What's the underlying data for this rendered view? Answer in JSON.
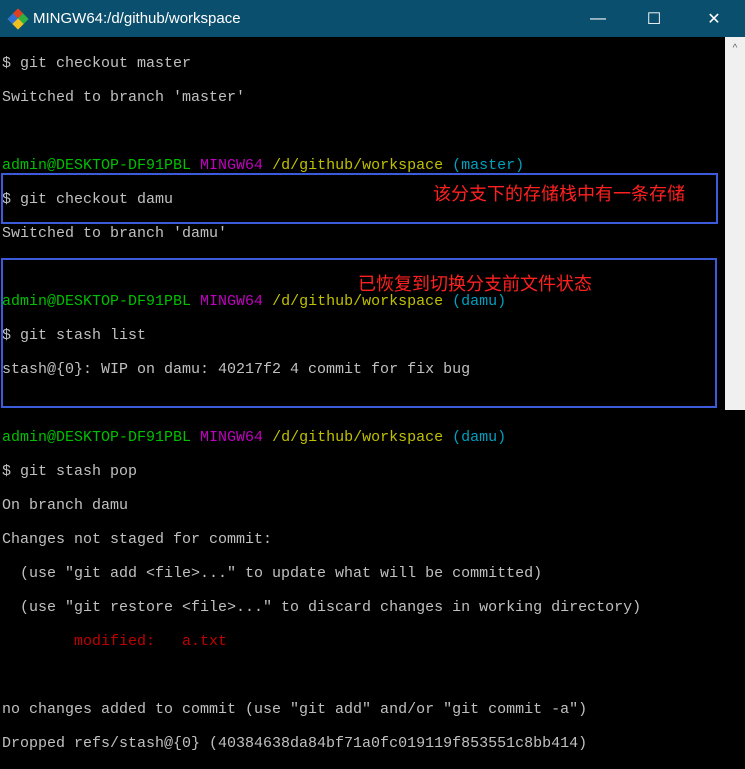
{
  "window": {
    "title": "MINGW64:/d/github/workspace",
    "minimize": "—",
    "maximize": "☐",
    "close": "✕"
  },
  "prompt": {
    "user": "admin@DESKTOP-DF91PBL",
    "sys": "MINGW64",
    "path": "/d/github/workspace"
  },
  "lines": {
    "l0": "$ git checkout master",
    "l1": "Switched to branch 'master'",
    "b3": "(master)",
    "l4": "$ git checkout damu",
    "l5": "Switched to branch 'damu'",
    "b7": "(damu)",
    "l8": "$ git stash list",
    "l9": "stash@{0}: WIP on damu: 40217f2 4 commit for fix bug",
    "b11": "(damu)",
    "l12": "$ git stash pop",
    "l13": "On branch damu",
    "l14": "Changes not staged for commit:",
    "l15": "  (use \"git add <file>...\" to update what will be committed)",
    "l16": "  (use \"git restore <file>...\" to discard changes in working directory)",
    "l17a": "        modified:   ",
    "l17b": "a.txt",
    "l19": "no changes added to commit (use \"git add\" and/or \"git commit -a\")",
    "l20": "Dropped refs/stash@{0} (40384638da84bf71a0fc019119f853551c8bb414)"
  },
  "annotations": {
    "stash_list": "该分支下的存储栈中有一条存储",
    "stash_pop": "已恢复到切换分支前文件状态"
  }
}
